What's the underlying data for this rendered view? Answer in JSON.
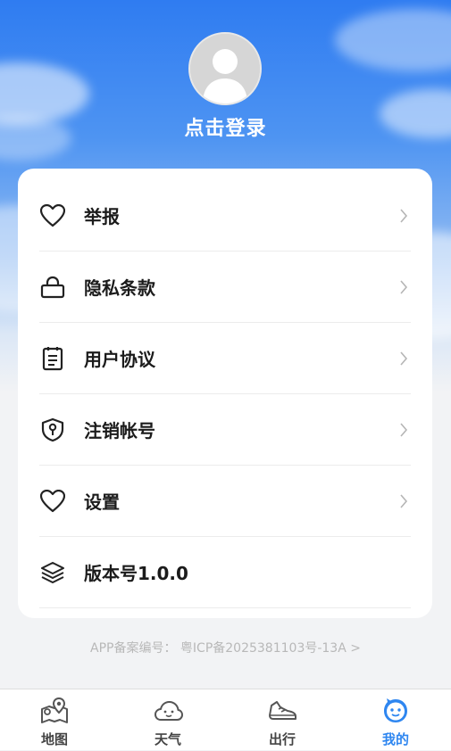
{
  "profile": {
    "login_label": "点击登录"
  },
  "menu": {
    "items": [
      {
        "label": "举报",
        "icon": "heart-icon"
      },
      {
        "label": "隐私条款",
        "icon": "lock-icon"
      },
      {
        "label": "用户协议",
        "icon": "document-icon"
      },
      {
        "label": "注销帐号",
        "icon": "shield-icon"
      },
      {
        "label": "设置",
        "icon": "heart-icon"
      },
      {
        "label": "版本号1.0.0",
        "icon": "layers-icon"
      }
    ]
  },
  "footer": {
    "icp_text": "APP备案编号：  粤ICP备2025381103号-13A >"
  },
  "tabbar": {
    "tabs": [
      {
        "label": "地图",
        "icon": "map-icon"
      },
      {
        "label": "天气",
        "icon": "weather-icon"
      },
      {
        "label": "出行",
        "icon": "shoe-icon"
      },
      {
        "label": "我的",
        "icon": "profile-face-icon",
        "active": true
      }
    ]
  },
  "colors": {
    "accent": "#2e86f0",
    "sky_top": "#2f7cf1",
    "page_bg": "#f2f3f5"
  }
}
